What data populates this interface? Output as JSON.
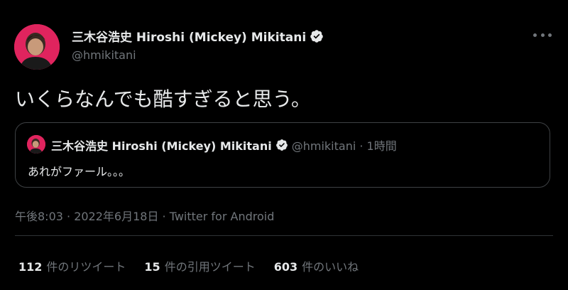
{
  "author": {
    "name": "三木谷浩史 Hiroshi (Mickey) Mikitani",
    "handle": "@hmikitani"
  },
  "tweet": {
    "text": "いくらなんでも酷すぎると思う。"
  },
  "quoted_tweet": {
    "name": "三木谷浩史 Hiroshi (Mickey) Mikitani",
    "meta": "@hmikitani · 1時間",
    "text": "あれがファール。。。"
  },
  "timestamp": "午後8:03 · 2022年6月18日 · Twitter for Android",
  "stats": [
    {
      "count": "112",
      "label": "件のリツイート"
    },
    {
      "count": "15",
      "label": "件の引用ツイート"
    },
    {
      "count": "603",
      "label": "件のいいね"
    }
  ],
  "icons": {
    "avatar": "avatar-icon",
    "verified": "verified-badge-icon",
    "more": "more-options-icon"
  },
  "colors": {
    "background": "#000000",
    "text_primary": "#e7e9ea",
    "text_secondary": "#71767b",
    "avatar_bg": "#e0245e",
    "border": "#3e4144"
  }
}
